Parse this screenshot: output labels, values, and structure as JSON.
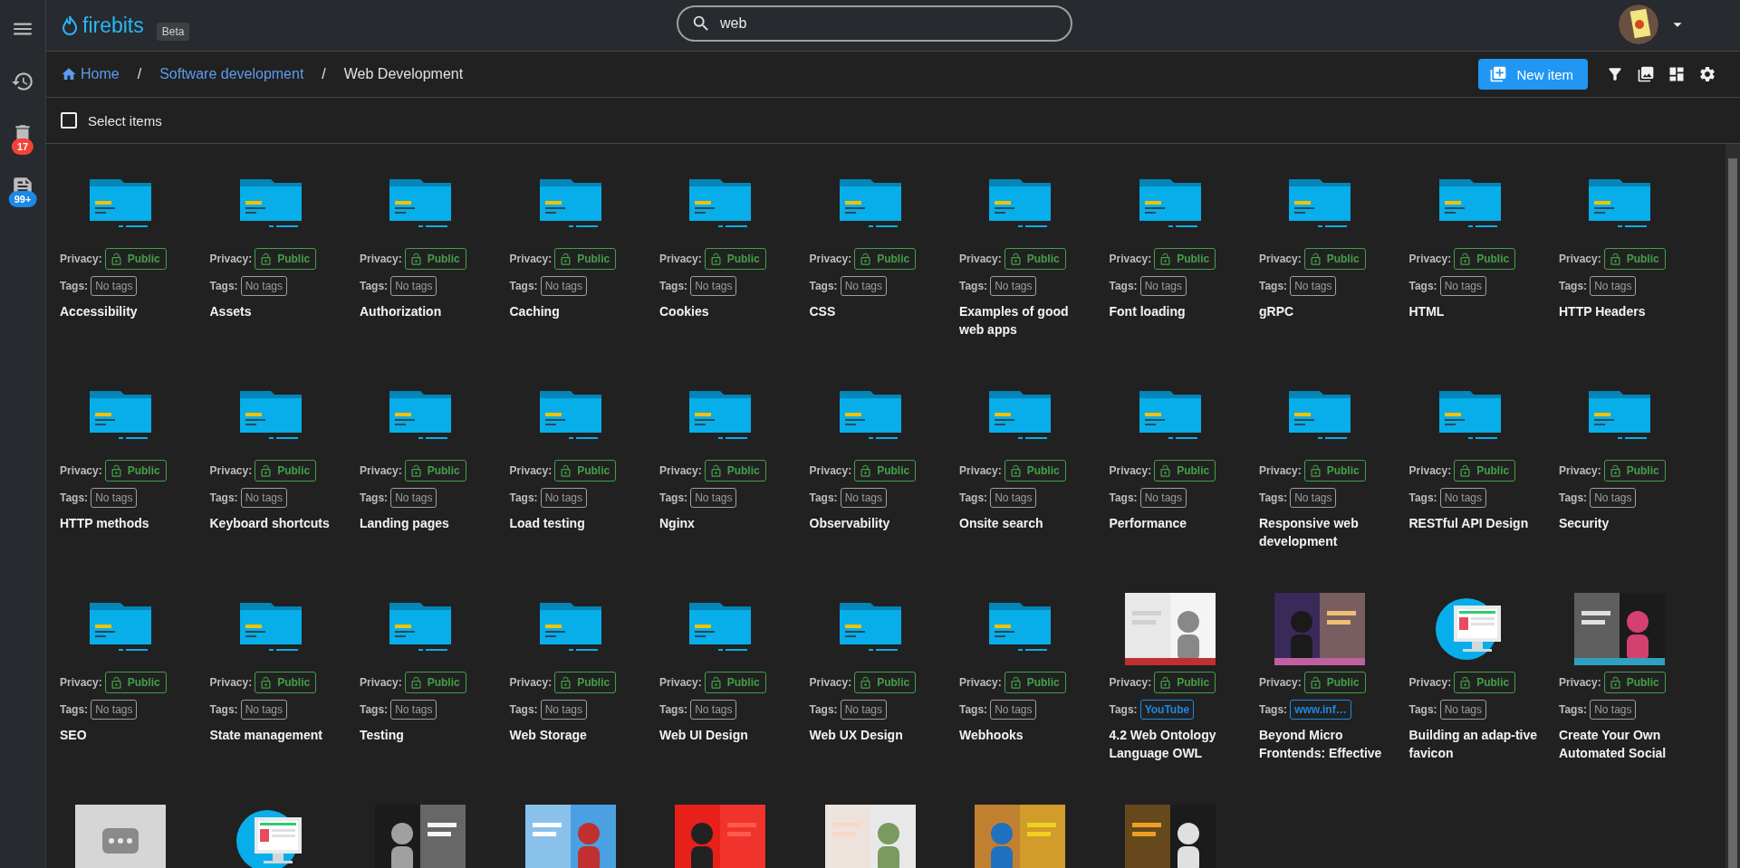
{
  "header": {
    "logo": "firebits",
    "badge": "Beta",
    "search": {
      "value": "web"
    }
  },
  "sidebar": {
    "items": [
      {
        "kind": "history"
      },
      {
        "kind": "trash",
        "badge": "17",
        "color": "#f44336"
      },
      {
        "kind": "feed",
        "badge": "99+",
        "color": "#1e88e5"
      }
    ]
  },
  "breadcrumb": [
    {
      "label": "Home",
      "kind": "home",
      "current": false
    },
    {
      "label": "/",
      "kind": "separator"
    },
    {
      "label": "Software development",
      "kind": "link",
      "current": false
    },
    {
      "label": "/",
      "kind": "separator"
    },
    {
      "label": "Web Development",
      "kind": "link",
      "current": true
    }
  ],
  "toolbar": {
    "new_item": "New item"
  },
  "select": {
    "label": "Select items",
    "checked": false
  },
  "items": [
    {
      "kind": "folder",
      "title": "Accessibility",
      "privacy_label": "Privacy:",
      "privacy": "Public",
      "tags_label": "Tags:",
      "tag": {
        "label": "No tags",
        "empty": true
      }
    },
    {
      "kind": "folder",
      "title": "Assets",
      "privacy_label": "Privacy:",
      "privacy": "Public",
      "tags_label": "Tags:",
      "tag": {
        "label": "No tags",
        "empty": true
      }
    },
    {
      "kind": "folder",
      "title": "Authorization",
      "privacy_label": "Privacy:",
      "privacy": "Public",
      "tags_label": "Tags:",
      "tag": {
        "label": "No tags",
        "empty": true
      }
    },
    {
      "kind": "folder",
      "title": "Caching",
      "privacy_label": "Privacy:",
      "privacy": "Public",
      "tags_label": "Tags:",
      "tag": {
        "label": "No tags",
        "empty": true
      }
    },
    {
      "kind": "folder",
      "title": "Cookies",
      "privacy_label": "Privacy:",
      "privacy": "Public",
      "tags_label": "Tags:",
      "tag": {
        "label": "No tags",
        "empty": true
      }
    },
    {
      "kind": "folder",
      "title": "CSS",
      "privacy_label": "Privacy:",
      "privacy": "Public",
      "tags_label": "Tags:",
      "tag": {
        "label": "No tags",
        "empty": true
      }
    },
    {
      "kind": "folder",
      "title": "Examples of good web apps",
      "privacy_label": "Privacy:",
      "privacy": "Public",
      "tags_label": "Tags:",
      "tag": {
        "label": "No tags",
        "empty": true
      }
    },
    {
      "kind": "folder",
      "title": "Font loading",
      "privacy_label": "Privacy:",
      "privacy": "Public",
      "tags_label": "Tags:",
      "tag": {
        "label": "No tags",
        "empty": true
      }
    },
    {
      "kind": "folder",
      "title": "gRPC",
      "privacy_label": "Privacy:",
      "privacy": "Public",
      "tags_label": "Tags:",
      "tag": {
        "label": "No tags",
        "empty": true
      }
    },
    {
      "kind": "folder",
      "title": "HTML",
      "privacy_label": "Privacy:",
      "privacy": "Public",
      "tags_label": "Tags:",
      "tag": {
        "label": "No tags",
        "empty": true
      }
    },
    {
      "kind": "folder",
      "title": "HTTP Headers",
      "privacy_label": "Privacy:",
      "privacy": "Public",
      "tags_label": "Tags:",
      "tag": {
        "label": "No tags",
        "empty": true
      }
    },
    {
      "kind": "folder",
      "title": "HTTP methods",
      "privacy_label": "Privacy:",
      "privacy": "Public",
      "tags_label": "Tags:",
      "tag": {
        "label": "No tags",
        "empty": true
      }
    },
    {
      "kind": "folder",
      "title": "Keyboard shortcuts",
      "privacy_label": "Privacy:",
      "privacy": "Public",
      "tags_label": "Tags:",
      "tag": {
        "label": "No tags",
        "empty": true
      }
    },
    {
      "kind": "folder",
      "title": "Landing pages",
      "privacy_label": "Privacy:",
      "privacy": "Public",
      "tags_label": "Tags:",
      "tag": {
        "label": "No tags",
        "empty": true
      }
    },
    {
      "kind": "folder",
      "title": "Load testing",
      "privacy_label": "Privacy:",
      "privacy": "Public",
      "tags_label": "Tags:",
      "tag": {
        "label": "No tags",
        "empty": true
      }
    },
    {
      "kind": "folder",
      "title": "Nginx",
      "privacy_label": "Privacy:",
      "privacy": "Public",
      "tags_label": "Tags:",
      "tag": {
        "label": "No tags",
        "empty": true
      }
    },
    {
      "kind": "folder",
      "title": "Observability",
      "privacy_label": "Privacy:",
      "privacy": "Public",
      "tags_label": "Tags:",
      "tag": {
        "label": "No tags",
        "empty": true
      }
    },
    {
      "kind": "folder",
      "title": "Onsite search",
      "privacy_label": "Privacy:",
      "privacy": "Public",
      "tags_label": "Tags:",
      "tag": {
        "label": "No tags",
        "empty": true
      }
    },
    {
      "kind": "folder",
      "title": "Performance",
      "privacy_label": "Privacy:",
      "privacy": "Public",
      "tags_label": "Tags:",
      "tag": {
        "label": "No tags",
        "empty": true
      }
    },
    {
      "kind": "folder",
      "title": "Responsive web development",
      "privacy_label": "Privacy:",
      "privacy": "Public",
      "tags_label": "Tags:",
      "tag": {
        "label": "No tags",
        "empty": true
      }
    },
    {
      "kind": "folder",
      "title": "RESTful API Design",
      "privacy_label": "Privacy:",
      "privacy": "Public",
      "tags_label": "Tags:",
      "tag": {
        "label": "No tags",
        "empty": true
      }
    },
    {
      "kind": "folder",
      "title": "Security",
      "privacy_label": "Privacy:",
      "privacy": "Public",
      "tags_label": "Tags:",
      "tag": {
        "label": "No tags",
        "empty": true
      }
    },
    {
      "kind": "folder",
      "title": "SEO",
      "privacy_label": "Privacy:",
      "privacy": "Public",
      "tags_label": "Tags:",
      "tag": {
        "label": "No tags",
        "empty": true
      }
    },
    {
      "kind": "folder",
      "title": "State management",
      "privacy_label": "Privacy:",
      "privacy": "Public",
      "tags_label": "Tags:",
      "tag": {
        "label": "No tags",
        "empty": true
      }
    },
    {
      "kind": "folder",
      "title": "Testing",
      "privacy_label": "Privacy:",
      "privacy": "Public",
      "tags_label": "Tags:",
      "tag": {
        "label": "No tags",
        "empty": true
      }
    },
    {
      "kind": "folder",
      "title": "Web Storage",
      "privacy_label": "Privacy:",
      "privacy": "Public",
      "tags_label": "Tags:",
      "tag": {
        "label": "No tags",
        "empty": true
      }
    },
    {
      "kind": "folder",
      "title": "Web UI Design",
      "privacy_label": "Privacy:",
      "privacy": "Public",
      "tags_label": "Tags:",
      "tag": {
        "label": "No tags",
        "empty": true
      }
    },
    {
      "kind": "folder",
      "title": "Web UX Design",
      "privacy_label": "Privacy:",
      "privacy": "Public",
      "tags_label": "Tags:",
      "tag": {
        "label": "No tags",
        "empty": true
      }
    },
    {
      "kind": "folder",
      "title": "Webhooks",
      "privacy_label": "Privacy:",
      "privacy": "Public",
      "tags_label": "Tags:",
      "tag": {
        "label": "No tags",
        "empty": true
      }
    },
    {
      "kind": "picture",
      "title": "4.2 Web Ontology Language OWL",
      "privacy_label": "Privacy:",
      "privacy": "Public",
      "tags_label": "Tags:",
      "tag": {
        "label": "YouTube",
        "empty": false
      }
    },
    {
      "kind": "picture",
      "title": "Beyond Micro Frontends: Effective",
      "privacy_label": "Privacy:",
      "privacy": "Public",
      "tags_label": "Tags:",
      "tag": {
        "label": "www.inf…",
        "empty": false
      }
    },
    {
      "kind": "monitor",
      "title": "Building an adap-tive favicon",
      "privacy_label": "Privacy:",
      "privacy": "Public",
      "tags_label": "Tags:",
      "tag": {
        "label": "No tags",
        "empty": true
      }
    },
    {
      "kind": "picture",
      "title": "Create Your Own Automated Social",
      "privacy_label": "Privacy:",
      "privacy": "Public",
      "tags_label": "Tags:",
      "tag": {
        "label": "No tags",
        "empty": true
      }
    },
    {
      "kind": "dots"
    },
    {
      "kind": "monitor"
    },
    {
      "kind": "picture"
    },
    {
      "kind": "picture"
    },
    {
      "kind": "picture"
    },
    {
      "kind": "picture"
    },
    {
      "kind": "picture"
    },
    {
      "kind": "picture"
    }
  ]
}
